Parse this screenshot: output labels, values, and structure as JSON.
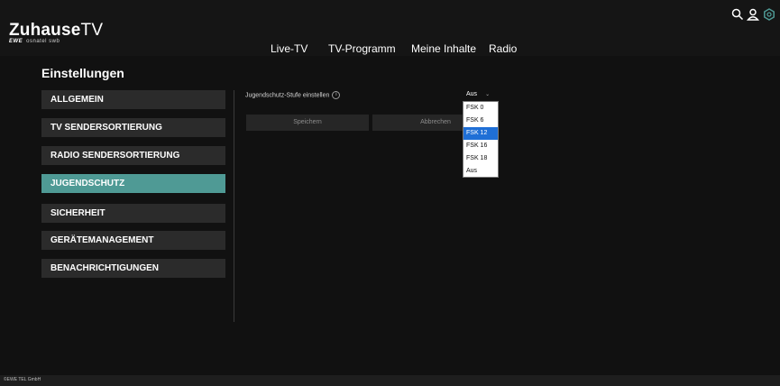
{
  "brand": {
    "name_main": "Zuhause",
    "name_tv": "TV",
    "sub_ewe": "EWE",
    "sub_rest": "osnatel swb"
  },
  "nav": [
    "Live-TV",
    "TV-Programm",
    "Meine Inhalte",
    "Radio"
  ],
  "settings": {
    "title": "Einstellungen",
    "items": [
      {
        "label": "ALLGEMEIN",
        "active": false
      },
      {
        "label": "TV SENDERSORTIERUNG",
        "active": false
      },
      {
        "label": "RADIO SENDERSORTIERUNG",
        "active": false
      },
      {
        "label": "JUGENDSCHUTZ",
        "active": true
      },
      {
        "label": "SICHERHEIT",
        "active": false
      },
      {
        "label": "GERÄTEMANAGEMENT",
        "active": false
      },
      {
        "label": "BENACHRICHTIGUNGEN",
        "active": false
      }
    ]
  },
  "parental": {
    "label": "Jugendschutz-Stufe einstellen",
    "info": "i",
    "selected": "Aus",
    "options": [
      "FSK 0",
      "FSK 6",
      "FSK 12",
      "FSK 16",
      "FSK 18",
      "Aus"
    ],
    "highlighted_option": "FSK 12",
    "save_label": "Speichern",
    "cancel_label": "Abbrechen"
  },
  "footer": {
    "text": "©EWE TEL GmbH"
  },
  "colors": {
    "accent": "#4f9a95",
    "background": "#111111",
    "panel": "#2b2b2b",
    "highlight": "#1f6fd6"
  },
  "icons": [
    "search-icon",
    "user-icon",
    "settings-icon"
  ]
}
